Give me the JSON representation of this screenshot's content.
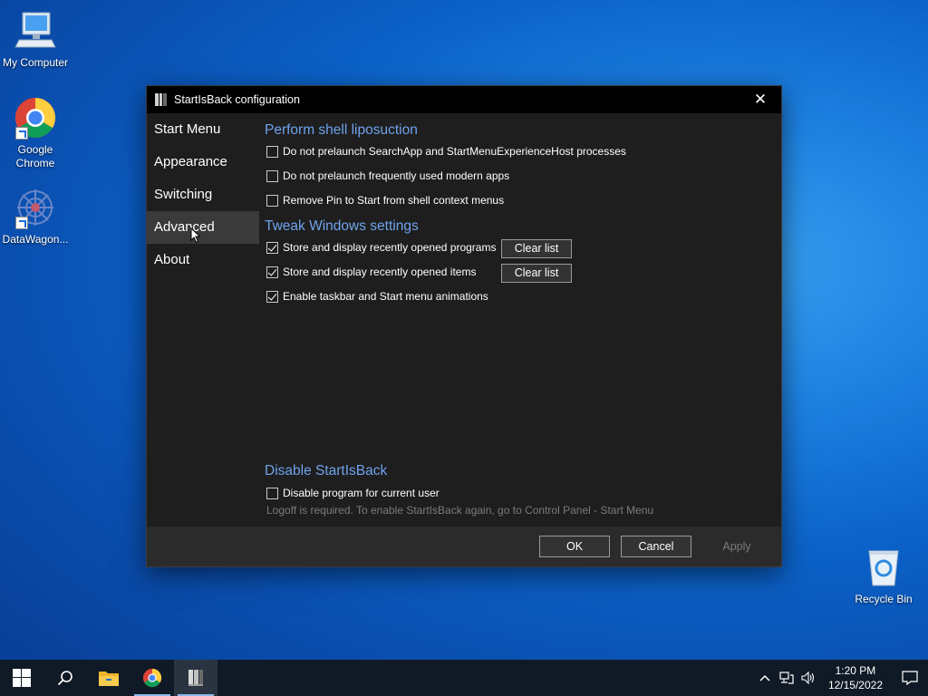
{
  "desktop": {
    "icons": [
      {
        "label": "My Computer",
        "icon": "computer-icon"
      },
      {
        "label": "Google Chrome",
        "icon": "chrome-icon"
      },
      {
        "label": "DataWagon...",
        "icon": "app-icon"
      },
      {
        "label": "Recycle Bin",
        "icon": "recycle-bin-icon"
      }
    ]
  },
  "dialog": {
    "title": "StartIsBack configuration",
    "close_glyph": "✕",
    "sidebar": {
      "items": [
        {
          "label": "Start Menu",
          "active": false
        },
        {
          "label": "Appearance",
          "active": false
        },
        {
          "label": "Switching",
          "active": false
        },
        {
          "label": "Advanced",
          "active": true
        },
        {
          "label": "About",
          "active": false
        }
      ]
    },
    "sections": {
      "shell": {
        "title": "Perform shell liposuction",
        "options": [
          {
            "label": "Do not prelaunch SearchApp and StartMenuExperienceHost processes",
            "checked": false
          },
          {
            "label": "Do not prelaunch frequently used modern apps",
            "checked": false
          },
          {
            "label": "Remove Pin to Start from shell context menus",
            "checked": false
          }
        ]
      },
      "tweak": {
        "title": "Tweak Windows settings",
        "options": [
          {
            "label": "Store and display recently opened programs",
            "checked": true,
            "button": "Clear list"
          },
          {
            "label": "Store and display recently opened items",
            "checked": true,
            "button": "Clear list"
          },
          {
            "label": "Enable taskbar and Start menu animations",
            "checked": true
          }
        ]
      },
      "disable": {
        "title": "Disable StartIsBack",
        "options": [
          {
            "label": "Disable program for current user",
            "checked": false
          }
        ],
        "note": "Logoff is required. To enable StartIsBack again, go to Control Panel - Start Menu"
      }
    },
    "footer": {
      "ok": "OK",
      "cancel": "Cancel",
      "apply": "Apply"
    }
  },
  "taskbar": {
    "buttons": [
      {
        "name": "start-button",
        "icon": "windows-logo-icon"
      },
      {
        "name": "search-button",
        "icon": "search-icon"
      },
      {
        "name": "file-explorer-button",
        "icon": "folder-icon"
      },
      {
        "name": "chrome-taskbar-button",
        "icon": "chrome-icon"
      },
      {
        "name": "startisback-taskbar-button",
        "icon": "startisback-icon"
      }
    ],
    "tray": {
      "icons": [
        "chevron-up-icon",
        "network-icon",
        "volume-icon"
      ],
      "time": "1:20 PM",
      "date": "12/15/2022",
      "notification_icon": "notification-icon"
    }
  },
  "colors": {
    "accent_heading": "#6fa3ec",
    "dialog_bg": "#1e1e1e",
    "taskbar_bg": "#101a26"
  }
}
